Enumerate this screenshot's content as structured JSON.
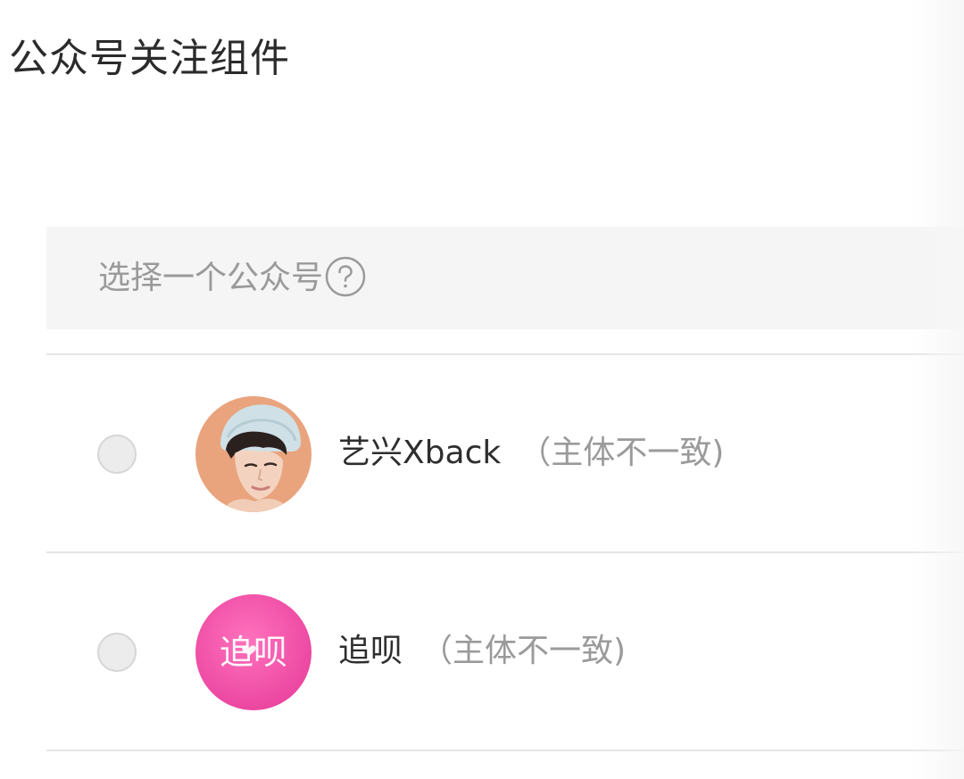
{
  "page": {
    "title": "公众号关注组件"
  },
  "select_header": {
    "label": "选择一个公众号",
    "help_icon": "question-circle-icon"
  },
  "accounts": [
    {
      "name": "艺兴Xback",
      "note": "（主体不一致)",
      "selected": false,
      "avatar": "person-photo-avatar"
    },
    {
      "name": "追呗",
      "note": "（主体不一致)",
      "selected": false,
      "avatar": "brand-logo-avatar",
      "avatar_logo_text": "追呗",
      "avatar_color": "#f04fa6"
    }
  ],
  "colors": {
    "header_bg": "#f5f5f5",
    "divider": "#e5e5e5",
    "muted_text": "#9a9a9a",
    "primary_text": "#2e2e2e",
    "brand_pink": "#f04fa6"
  }
}
